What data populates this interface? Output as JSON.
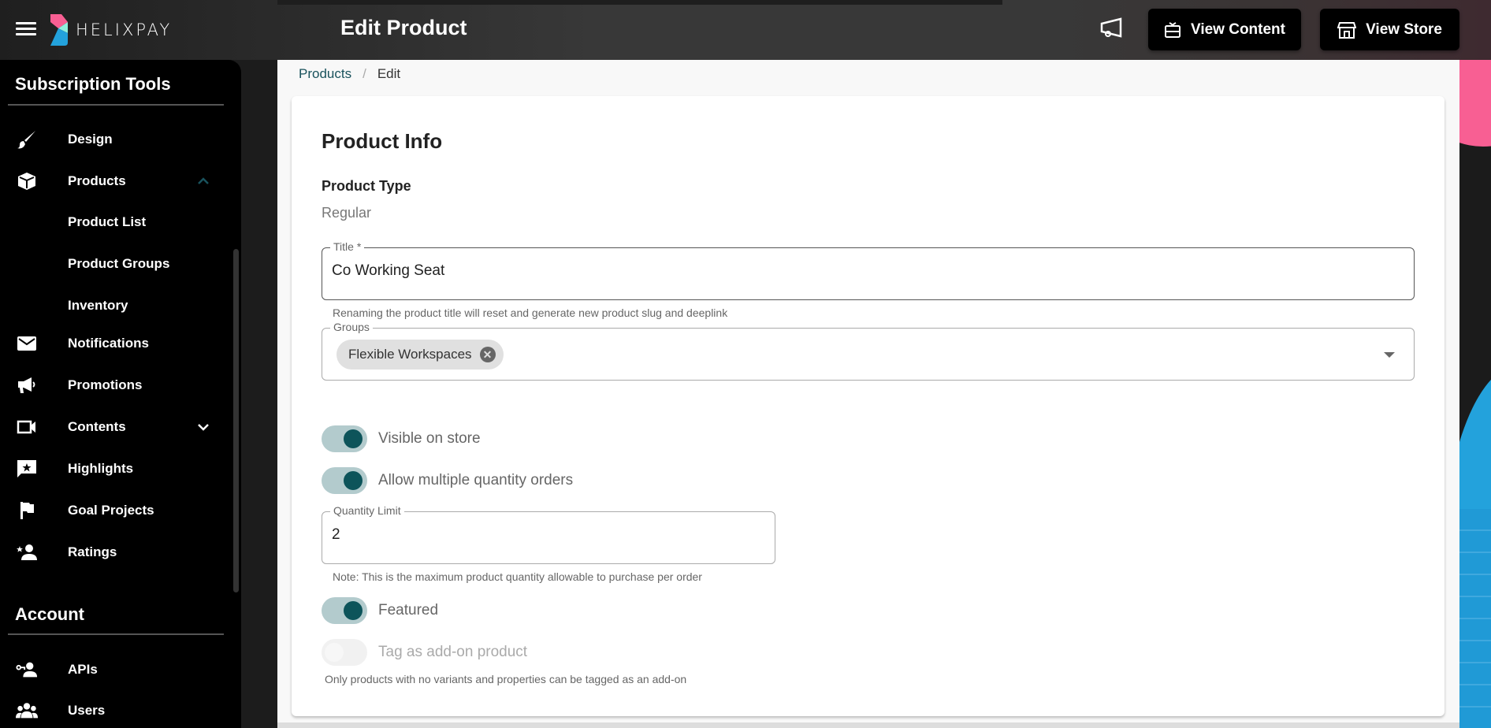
{
  "header": {
    "brand": "HELIXPAY",
    "page_title": "Edit Product",
    "buttons": {
      "view_content": "View Content",
      "view_store": "View Store"
    },
    "icons": [
      "menu-icon",
      "megaphone-outline-icon",
      "gift-card-icon",
      "storefront-icon"
    ]
  },
  "sidebar": {
    "sections": [
      {
        "title": "Subscription Tools",
        "items": [
          {
            "label": "Design",
            "icon": "brush-icon"
          },
          {
            "label": "Products",
            "icon": "package-icon",
            "expanded": true
          },
          {
            "label": "Product List",
            "sub": true
          },
          {
            "label": "Product Groups",
            "sub": true
          },
          {
            "label": "Inventory",
            "sub": true
          },
          {
            "label": "Notifications",
            "icon": "mail-icon"
          },
          {
            "label": "Promotions",
            "icon": "megaphone-icon"
          },
          {
            "label": "Contents",
            "icon": "video-icon",
            "expandable": true
          },
          {
            "label": "Highlights",
            "icon": "star-comment-icon"
          },
          {
            "label": "Goal Projects",
            "icon": "flag-icon"
          },
          {
            "label": "Ratings",
            "icon": "star-person-icon"
          }
        ]
      },
      {
        "title": "Account",
        "items": [
          {
            "label": "APIs",
            "icon": "key-person-icon"
          },
          {
            "label": "Users",
            "icon": "group-icon"
          }
        ]
      }
    ]
  },
  "breadcrumb": {
    "parent": "Products",
    "separator": "/",
    "current": "Edit"
  },
  "form": {
    "card_title": "Product Info",
    "product_type_label": "Product Type",
    "product_type_value": "Regular",
    "title_field": {
      "label": "Title *",
      "value": "Co Working Seat",
      "helper": "Renaming the product title will reset and generate new product slug and deeplink"
    },
    "groups_field": {
      "label": "Groups",
      "chips": [
        "Flexible Workspaces"
      ]
    },
    "toggles": {
      "visible_on_store": {
        "label": "Visible on store",
        "on": true
      },
      "allow_multiple": {
        "label": "Allow multiple quantity orders",
        "on": true
      },
      "featured": {
        "label": "Featured",
        "on": true
      },
      "addon": {
        "label": "Tag as add-on product",
        "on": false,
        "disabled": true,
        "helper": "Only products with no variants and properties can be tagged as an add-on"
      }
    },
    "quantity_field": {
      "label": "Quantity Limit",
      "value": "2",
      "helper": "Note: This is the maximum product quantity allowable to purchase per order"
    }
  },
  "colors": {
    "accent": "#0d545a",
    "toggle_track": "#b3cbcd",
    "link": "#19525c",
    "brand_pink": "#f85f93",
    "brand_blue": "#23a2dc"
  }
}
